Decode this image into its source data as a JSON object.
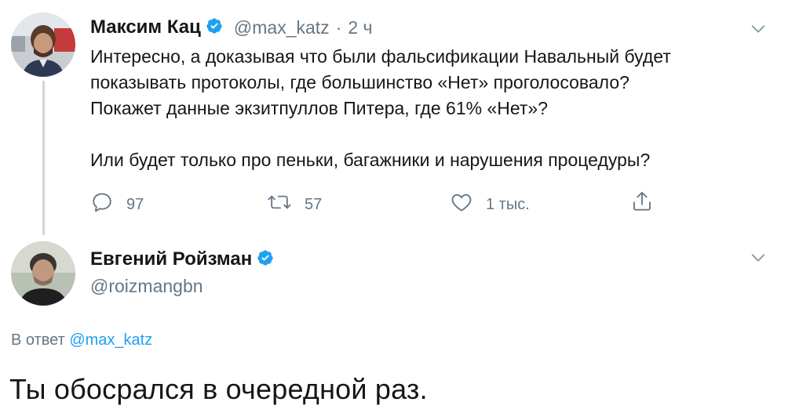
{
  "tweet1": {
    "author_name": "Максим Кац",
    "handle": "@max_katz",
    "separator": "·",
    "time": "2 ч",
    "text": "Интересно, а доказывая что были фальсификации Навальный будет\nпоказывать протоколы, где большинство «Нет» проголосовало?\nПокажет данные экзитпуллов Питера, где 61% «Нет»?\n\nИли будет только про пеньки, багажники и нарушения процедуры?",
    "actions": {
      "replies": "97",
      "retweets": "57",
      "likes": "1 тыс."
    }
  },
  "tweet2": {
    "author_name": "Евгений Ройзман",
    "handle": "@roizmangbn",
    "reply_prefix": "В ответ",
    "reply_to": "@max_katz",
    "text": "Ты обосрался в очередной раз."
  },
  "colors": {
    "verified_blue": "#1da1f2",
    "secondary_text": "#657786",
    "thread_line": "#ccd6dd"
  },
  "icons": [
    "verified-badge-icon",
    "chevron-down-icon",
    "reply-icon",
    "retweet-icon",
    "like-icon",
    "share-icon"
  ]
}
